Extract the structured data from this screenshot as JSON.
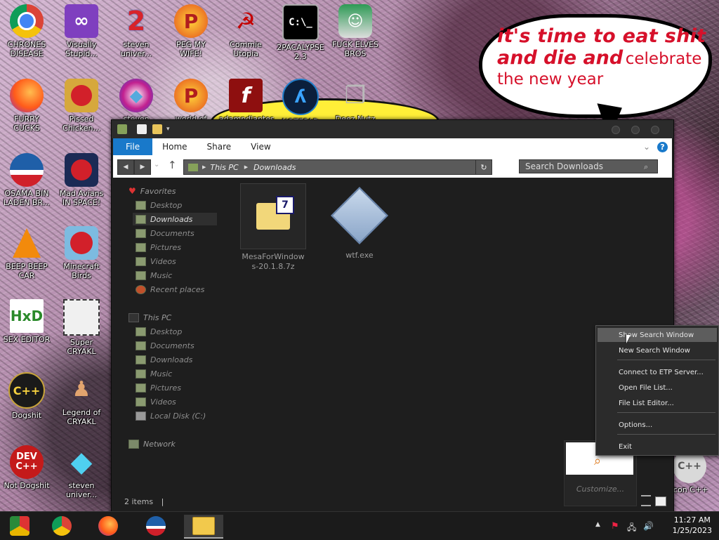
{
  "bubble": {
    "line1": "it's time to eat shit",
    "line2_bold": "and die and",
    "line2_rest": "celebrate",
    "line3": "the new year"
  },
  "desktop_icons": [
    {
      "label": "CHRONES DISEASE",
      "icon": "chrome-icon"
    },
    {
      "label": "Visually Stupid...",
      "icon": "visual-studio-icon"
    },
    {
      "label": "steven univer...",
      "icon": "steven-universe-icon"
    },
    {
      "label": "PEG MY WIFE!",
      "icon": "peggle-icon"
    },
    {
      "label": "Commie Utopia",
      "icon": "commie-utopia-icon"
    },
    {
      "label": "2PACALYPSE 2.3",
      "icon": "cmd-icon"
    },
    {
      "label": "FUCK ELVES BROS",
      "icon": "elf-icon"
    },
    {
      "label": "FURRY CUCKS",
      "icon": "firefox-icon"
    },
    {
      "label": "Pissed Chicken...",
      "icon": "angry-birds-seasons-icon"
    },
    {
      "label": "steven",
      "icon": "diamond-badge-icon"
    },
    {
      "label": "world of",
      "icon": "peggle-icon"
    },
    {
      "label": "adampdiaptes",
      "icon": "flash-icon"
    },
    {
      "label": "NOTEPAD",
      "icon": "notepad-icon"
    },
    {
      "label": "Deez Nutz",
      "icon": "copy-icon"
    },
    {
      "label": "OSAMA BIN LADEN BR...",
      "icon": "obama-logo-icon"
    },
    {
      "label": "Mad Avians IN SPACE!",
      "icon": "angry-birds-space-icon"
    },
    {
      "label": "BEEP BEEP CAR",
      "icon": "vlc-icon"
    },
    {
      "label": "Minecraft Birds",
      "icon": "angry-birds-icon"
    },
    {
      "label": "SEX EDITOR",
      "icon": "hxd-icon"
    },
    {
      "label": "Super CRYAKL",
      "icon": "pixel-cat-icon"
    },
    {
      "label": "Dogshit",
      "icon": "dogshit-cpp-icon"
    },
    {
      "label": "Legend of CRYAKL",
      "icon": "pixel-hero-icon"
    },
    {
      "label": "Not Dogshit",
      "icon": "dev-cpp-icon"
    },
    {
      "label": "steven univer...",
      "icon": "gem-icon"
    },
    {
      "label": "Icon C++",
      "icon": "cpp-icon"
    }
  ],
  "explorer": {
    "ribbon_tabs": [
      "File",
      "Home",
      "Share",
      "View"
    ],
    "address": {
      "root": "This PC",
      "current": "Downloads"
    },
    "search_placeholder": "Search Downloads",
    "help": "?",
    "nav": {
      "favorites_label": "Favorites",
      "favorites": [
        "Desktop",
        "Downloads",
        "Documents",
        "Pictures",
        "Videos",
        "Music",
        "Recent places"
      ],
      "thispc_label": "This PC",
      "thispc": [
        "Desktop",
        "Documents",
        "Downloads",
        "Music",
        "Pictures",
        "Videos",
        "Local Disk (C:)"
      ],
      "network_label": "Network"
    },
    "files": [
      {
        "name": "MesaForWindows-20.1.8.7z",
        "name_line1": "MesaForWindow",
        "name_line2": "s-20.1.8.7z",
        "icon": "7z-archive-icon"
      },
      {
        "name": "wtf.exe",
        "icon": "exe-icon"
      }
    ],
    "status": "2 items"
  },
  "context_menu": {
    "items": [
      "Show Search Window",
      "New Search Window",
      "Connect to ETP Server...",
      "Open File List...",
      "File List Editor...",
      "Options...",
      "Exit"
    ]
  },
  "tray_popup": {
    "customize": "Customize..."
  },
  "taskbar": {
    "apps": [
      "chromium-icon",
      "chrome-icon",
      "firefox-icon",
      "obama-logo-icon",
      "file-explorer-icon"
    ],
    "time": "11:27 AM",
    "date": "1/25/2023"
  },
  "colors": {
    "accent": "#1979ca",
    "bubble_text": "#d6102a",
    "window_bg": "#1e1e1e"
  }
}
